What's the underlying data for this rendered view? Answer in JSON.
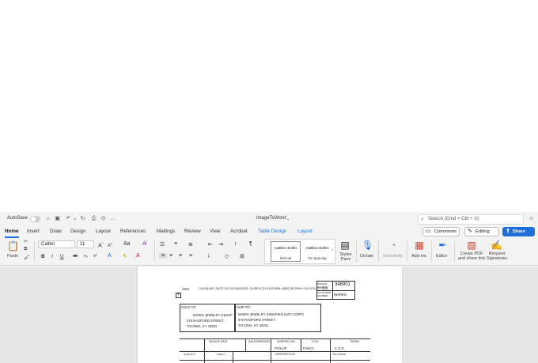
{
  "titlebar": {
    "autosave_label": "AutoSave",
    "doc_title": "ImageToWord",
    "search_placeholder": "Search (Cmd + Ctrl + U)"
  },
  "tabs": [
    "Home",
    "Insert",
    "Draw",
    "Design",
    "Layout",
    "References",
    "Mailings",
    "Review",
    "View",
    "Acrobat",
    "Table Design",
    "Layout"
  ],
  "actions": {
    "comments": "Comments",
    "editing": "Editing",
    "share": "Share"
  },
  "ribbon": {
    "paste": "Paste",
    "font_name": "Calibri",
    "font_size": "11",
    "style_normal_sample": "AaBbCcDdEe",
    "style_normal": "Normal",
    "style_nospacing_sample": "AaBbCcDdEe",
    "style_nospacing": "No Spacing",
    "styles_pane": "Styles\nPane",
    "dictate": "Dictate",
    "sensitivity": "Sensitivity",
    "addins": "Add-ins",
    "editor": "Editor",
    "create_pdf": "Create PDF\nand share link",
    "request_signatures": "Request\nSignatures"
  },
  "document": {
    "header_small": "19HI",
    "address_line": "DALEN AVE, SUITE 110 LOS ANGELES, CA 90010 (213) 623-4598 • (800) 282-9099 • FAX (213) 627-9948",
    "invoice_number_label": "INVOICE NUMBER",
    "invoice_number": "348901",
    "customer_number_label": "CUSTOMER NUMBER",
    "customer_number": "MARINI",
    "sold_to_label": "SOLD TO:",
    "sold_to_name": "MARIN JEWELRY (HIGHF",
    "sold_to_street": "576 RADFORD STREET.",
    "sold_to_city": "TACOMA, KY 40201",
    "ship_to_label": "SHIP TO:",
    "ship_to_name": "MARIN JEWELRY (HIGHFIED (URY CORP)",
    "ship_to_street": "576 RADFORD STREET.",
    "ship_to_city": "TACOMA, KY 40201",
    "col_invoice_date": "INVOICE DATE",
    "col_salesperson": "SALESPERSON",
    "col_shipped_via": "SHIPPED VIA",
    "col_fob": "F.O.B.",
    "col_terms": "TERMS",
    "shipped_via_value": "PICKUP",
    "fob_value": "FANCY",
    "terms_value": "C.O.D.",
    "col_quantity": "QUANTITY",
    "col_item": "ITEM #",
    "col_description": "DESCRIPTION",
    "col_unit_price": "UNIT PRICE"
  },
  "colors": {
    "accent": "#1e6fd9",
    "ribbon_bg": "#f3f3f3",
    "doc_bg": "#e7e7e7"
  }
}
